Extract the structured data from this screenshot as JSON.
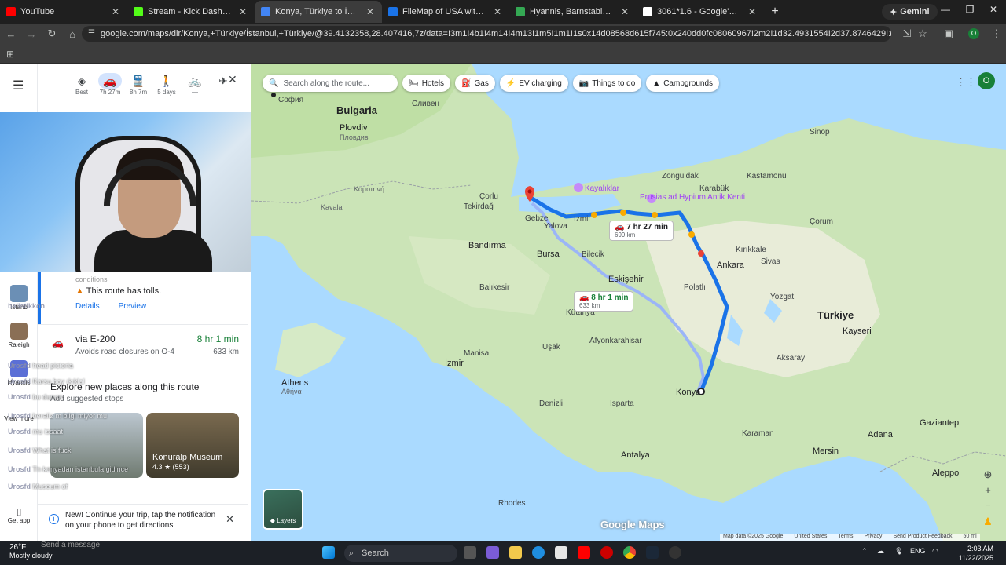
{
  "browser": {
    "tabs": [
      {
        "title": "YouTube",
        "color": "#ff0000"
      },
      {
        "title": "Stream - Kick Dashboard",
        "color": "#53fc18"
      },
      {
        "title": "Konya, Türkiye to İstanbul, Türk",
        "color": "#4285f4"
      },
      {
        "title": "FileMap of USA with state nam",
        "color": "#1a73e8"
      },
      {
        "title": "Hyannis, Barnstable, Massachu",
        "color": "#34a853"
      },
      {
        "title": "3061*1.6 - Google'da Ara",
        "color": "#ffffff"
      }
    ],
    "active_tab": 2,
    "gemini_label": "Gemini",
    "url": "google.com/maps/dir/Konya,+Türkiye/İstanbul,+Türkiye/@39.4132358,28.407416,7z/data=!3m1!4b1!4m14!4m13!1m5!1m1!1s0x14d08568d615f745:0x240dd0fc08060967!2m2!1d32.4931554!2d37.8746429!1m5!1m1!1s0x14caa7040068086b:0xe..."
  },
  "sidebar": {
    "modes": [
      {
        "icon": "◈",
        "label": "Best"
      },
      {
        "icon": "🚗",
        "label": "7h 27m"
      },
      {
        "icon": "🚆",
        "label": "8h 7m"
      },
      {
        "icon": "🚶",
        "label": "5 days"
      },
      {
        "icon": "🚲",
        "label": "—"
      },
      {
        "icon": "✈",
        "label": ""
      }
    ],
    "recents": [
      {
        "label": "İstanb"
      },
      {
        "label": "Raleigh"
      },
      {
        "label": "Hyannis"
      },
      {
        "label": "View more"
      }
    ],
    "route_faded": "conditions",
    "tolls_warning": "This route has tolls.",
    "details_link": "Details",
    "preview_link": "Preview",
    "alt_route": {
      "via": "via E-200",
      "sub": "Avoids road closures on O-4",
      "time": "8 hr 1 min",
      "distance": "633 km"
    },
    "explore_title": "Explore new places along this route",
    "explore_sub": "Add suggested stops",
    "places": [
      {
        "name": "",
        "rating": ""
      },
      {
        "name": "Konuralp Museum",
        "rating": "4.3 ★ (553)"
      }
    ],
    "notification": "New! Continue your trip, tap the notification on your phone to get directions",
    "get_app": "Get app"
  },
  "chat": [
    {
      "user": "ballstikkon",
      "msg": ""
    },
    {
      "user": "Urosfd",
      "msg": "head pictoria"
    },
    {
      "user": "Urosfd",
      "msg": "Karsu boy ıkıklal"
    },
    {
      "user": "Urosfd",
      "msg": "bu durum"
    },
    {
      "user": "Urosfd",
      "msg": "beraliz m bilgi miyor mu"
    },
    {
      "user": "Urosfd",
      "msg": "mu issaat"
    },
    {
      "user": "Urosfd",
      "msg": "What is fuck"
    },
    {
      "user": "Urosfd",
      "msg": "Tn konyadan istanbula gidince"
    },
    {
      "user": "Urosfd",
      "msg": "Museum of"
    }
  ],
  "map": {
    "search_placeholder": "Search along the route...",
    "chips": [
      {
        "icon": "🛏",
        "label": "Hotels"
      },
      {
        "icon": "⛽",
        "label": "Gas"
      },
      {
        "icon": "⚡",
        "label": "EV charging"
      },
      {
        "icon": "📷",
        "label": "Things to do"
      },
      {
        "icon": "▲",
        "label": "Campgrounds"
      }
    ],
    "account_initial": "O",
    "labels": {
      "bulgaria": "Bulgaria",
      "sofia": "София",
      "sliven": "Сливен",
      "plovdiv": "Plovdiv",
      "plovdiv_cyr": "Пловдив",
      "turkiye": "Türkiye",
      "istanbul_area": "Çorlu",
      "tekirdag": "Tekirdağ",
      "bursa": "Bursa",
      "eskisehir": "Eskişehir",
      "ankara": "Ankara",
      "konya": "Konya",
      "izmir": "İzmir",
      "athens": "Athens",
      "athens_gr": "Αθήνα",
      "antalya": "Antalya",
      "kayseri": "Kayseri",
      "adana": "Adana",
      "mersin": "Mersin",
      "aleppo": "Aleppo",
      "gaziantep": "Gaziantep",
      "sivas": "Sivas",
      "corum": "Çorum",
      "samsun_sinop": "Sinop",
      "zonguldak": "Zonguldak",
      "karabuk": "Karabük",
      "kastamonu": "Kastamonu",
      "izmit": "İzmit",
      "gebze": "Gebze",
      "bandirma": "Bandırma",
      "balikesir": "Balıkesir",
      "manisa": "Manisa",
      "usak": "Uşak",
      "afyon": "Afyonkarahisar",
      "kutahya": "Kütahya",
      "denizli": "Denizli",
      "isparta": "Isparta",
      "aksaray": "Aksaray",
      "karaman": "Karaman",
      "polatli": "Polatlı",
      "rhodes": "Rhodes",
      "kavala": "Kavala",
      "komotini": "Κομοτηνή",
      "kayalikler": "Kayalıklar",
      "prusias": "Prusias ad Hypium Antik Kenti",
      "yozgat": "Yozgat",
      "kirikkale": "Kırıkkale",
      "bilecik": "Bilecik",
      "yalova": "Yalova"
    },
    "callout_main": {
      "time": "7 hr 27 min",
      "dist": "699 km"
    },
    "callout_alt": {
      "time": "8 hr 1 min",
      "dist": "633 km"
    },
    "layers_label": "Layers",
    "brand": "Google Maps",
    "footer": [
      "Map data ©2025 Google",
      "United States",
      "Terms",
      "Privacy",
      "Send Product Feedback",
      "50 mi"
    ]
  },
  "taskbar": {
    "temp": "26°F",
    "weather": "Mostly cloudy",
    "search": "Search",
    "lang": "ENG",
    "time": "2:03 AM",
    "date": "11/22/2025",
    "message_placeholder": "Send a message"
  }
}
